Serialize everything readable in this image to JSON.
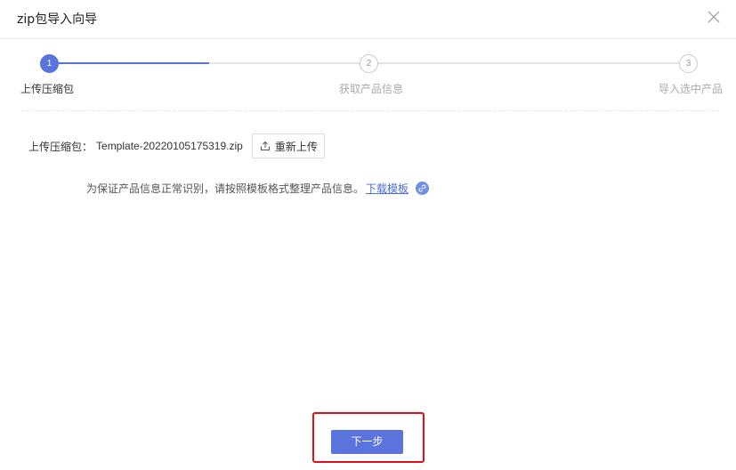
{
  "dialog": {
    "title": "zip包导入向导"
  },
  "steps": [
    {
      "number": "1",
      "label": "上传压缩包",
      "state": "active"
    },
    {
      "number": "2",
      "label": "获取产品信息",
      "state": "todo"
    },
    {
      "number": "3",
      "label": "导入选中产品",
      "state": "todo"
    }
  ],
  "upload": {
    "label": "上传压缩包：",
    "file_name": "Template-20220105175319.zip",
    "reupload_label": "重新上传"
  },
  "hint": {
    "text": "为保证产品信息正常识别，请按照模板格式整理产品信息。",
    "download_label": "下载模板"
  },
  "footer": {
    "next_label": "下一步"
  },
  "colors": {
    "accent": "#5b73dc",
    "highlight": "#e0101a",
    "link": "#4a6fd6"
  },
  "icons": [
    "close-icon",
    "upload-icon",
    "link-icon"
  ]
}
